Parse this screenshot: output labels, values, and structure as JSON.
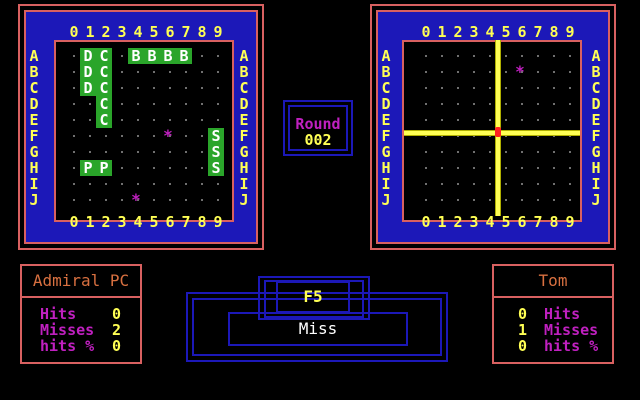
{
  "columns": [
    "0",
    "1",
    "2",
    "3",
    "4",
    "5",
    "6",
    "7",
    "8",
    "9"
  ],
  "rows": [
    "A",
    "B",
    "C",
    "D",
    "E",
    "F",
    "G",
    "H",
    "I",
    "J"
  ],
  "player_board": {
    "ships": [
      {
        "letter": "D",
        "cells": [
          [
            0,
            1
          ],
          [
            1,
            1
          ],
          [
            2,
            1
          ]
        ]
      },
      {
        "letter": "C",
        "cells": [
          [
            0,
            2
          ],
          [
            1,
            2
          ],
          [
            2,
            2
          ],
          [
            3,
            2
          ],
          [
            4,
            2
          ]
        ]
      },
      {
        "letter": "B",
        "cells": [
          [
            0,
            4
          ],
          [
            0,
            5
          ],
          [
            0,
            6
          ],
          [
            0,
            7
          ]
        ]
      },
      {
        "letter": "S",
        "cells": [
          [
            5,
            9
          ],
          [
            6,
            9
          ],
          [
            7,
            9
          ]
        ]
      },
      {
        "letter": "P",
        "cells": [
          [
            7,
            1
          ],
          [
            7,
            2
          ]
        ]
      }
    ],
    "shots": [
      [
        5,
        6
      ],
      [
        9,
        4
      ]
    ]
  },
  "enemy_board": {
    "shots": [
      [
        1,
        6
      ]
    ],
    "cursor": {
      "row": 5,
      "col": 5
    }
  },
  "round": {
    "label": "Round",
    "value": "002"
  },
  "left_player": {
    "name": "Admiral PC",
    "hits_label": "Hits",
    "misses_label": "Misses",
    "pct_label": "hits %",
    "hits": "0",
    "misses": "2",
    "pct": "0"
  },
  "right_player": {
    "name": "Tom",
    "hits_label": "Hits",
    "misses_label": "Misses",
    "pct_label": "hits %",
    "hits": "0",
    "misses": "1",
    "pct": "0"
  },
  "console": {
    "key": "F5",
    "message": "Miss"
  },
  "colors": {
    "board": "#1c18b8",
    "frame": "#d86060",
    "ship": "#2aa52a",
    "label": "#ffff54",
    "shot": "#c020c0"
  }
}
